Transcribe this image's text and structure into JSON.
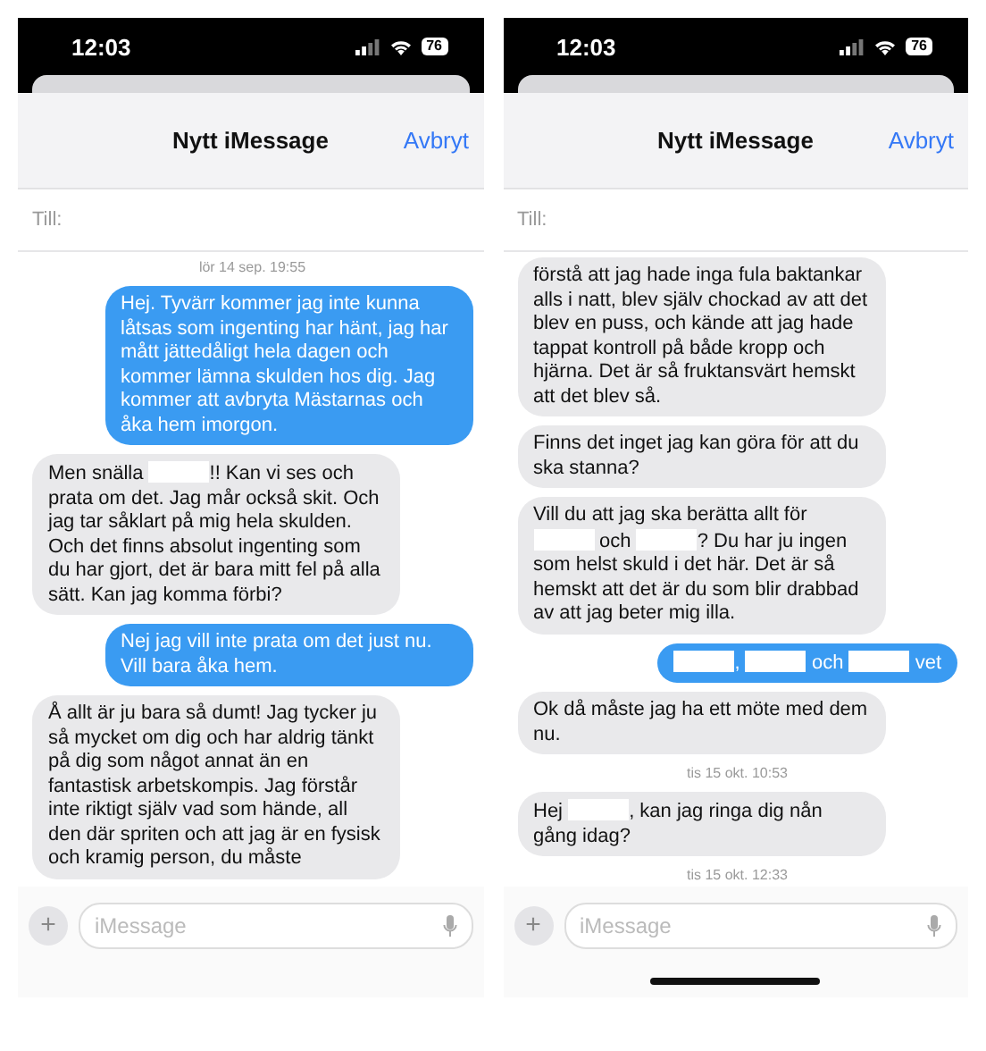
{
  "phones": [
    {
      "status_bar": {
        "time": "12:03",
        "battery": "76"
      },
      "title": "Nytt iMessage",
      "cancel": "Avbryt",
      "to_label": "Till:",
      "home_indicator": false,
      "items": [
        {
          "kind": "timestamp",
          "text": "lör 14 sep. 19:55"
        },
        {
          "kind": "sent",
          "parts": [
            {
              "kind": "text",
              "text": "Hej. Tyvärr kommer jag inte kunna låtsas som ingenting har hänt, jag har mått jättedåligt hela dagen och kommer lämna skulden hos dig. Jag kommer att avbryta Mästarnas och åka hem imorgon."
            }
          ]
        },
        {
          "kind": "received",
          "parts": [
            {
              "kind": "text",
              "text": "Men snälla "
            },
            {
              "kind": "redacted"
            },
            {
              "kind": "text",
              "text": "!! Kan vi ses och prata om det. Jag mår också skit. Och jag tar såklart på mig hela skulden. Och det finns absolut ingenting som du har gjort, det är bara mitt fel på alla sätt. Kan jag komma förbi?"
            }
          ]
        },
        {
          "kind": "sent",
          "parts": [
            {
              "kind": "text",
              "text": "Nej jag vill inte prata om det just nu. Vill bara åka hem."
            }
          ]
        },
        {
          "kind": "received",
          "parts": [
            {
              "kind": "text",
              "text": "Å allt är ju bara så dumt! Jag tycker ju så mycket om dig och har aldrig tänkt på dig som något annat än en fantastisk arbetskompis. Jag förstår inte riktigt själv vad som hände, all den där spriten och att jag är en fysisk och kramig person, du måste"
            }
          ]
        }
      ],
      "composer": {
        "plus": "+",
        "placeholder": "iMessage"
      }
    },
    {
      "status_bar": {
        "time": "12:03",
        "battery": "76"
      },
      "title": "Nytt iMessage",
      "cancel": "Avbryt",
      "to_label": "Till:",
      "home_indicator": true,
      "items": [
        {
          "kind": "received",
          "parts": [
            {
              "kind": "text",
              "text": "förstå att jag hade inga fula baktankar alls i natt, blev själv chockad av att det blev en puss, och kände att jag hade tappat kontroll på både kropp och hjärna. Det är så fruktansvärt hemskt att det blev så."
            }
          ]
        },
        {
          "kind": "received",
          "parts": [
            {
              "kind": "text",
              "text": "Finns det inget jag kan göra för att du ska stanna?"
            }
          ]
        },
        {
          "kind": "received",
          "parts": [
            {
              "kind": "text",
              "text": "Vill du att jag ska berätta allt för "
            },
            {
              "kind": "redacted"
            },
            {
              "kind": "text",
              "text": " och "
            },
            {
              "kind": "redacted"
            },
            {
              "kind": "text",
              "text": "? Du har ju ingen som helst skuld i det här. Det är så hemskt att det är du som blir drabbad av att jag beter mig illa."
            }
          ]
        },
        {
          "kind": "sent",
          "parts": [
            {
              "kind": "redacted"
            },
            {
              "kind": "text",
              "text": ", "
            },
            {
              "kind": "redacted"
            },
            {
              "kind": "text",
              "text": " och "
            },
            {
              "kind": "redacted"
            },
            {
              "kind": "text",
              "text": " vet"
            }
          ]
        },
        {
          "kind": "received",
          "parts": [
            {
              "kind": "text",
              "text": "Ok då måste jag ha ett möte med dem nu."
            }
          ]
        },
        {
          "kind": "timestamp",
          "text": "tis 15 okt. 10:53"
        },
        {
          "kind": "received",
          "parts": [
            {
              "kind": "text",
              "text": "Hej "
            },
            {
              "kind": "redacted"
            },
            {
              "kind": "text",
              "text": ", kan jag ringa dig nån gång idag?"
            }
          ]
        },
        {
          "kind": "timestamp",
          "text": "tis 15 okt. 12:33"
        }
      ],
      "composer": {
        "plus": "+",
        "placeholder": "iMessage"
      }
    }
  ]
}
